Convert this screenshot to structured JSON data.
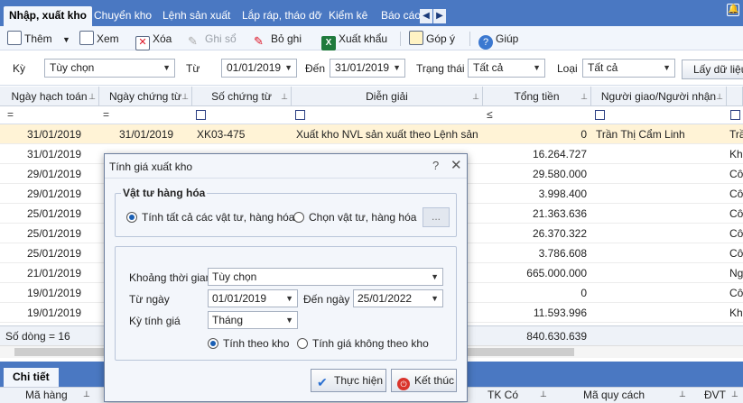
{
  "tabs": [
    "Nhập, xuất kho",
    "Chuyển kho",
    "Lệnh sản xuất",
    "Lắp ráp, tháo dỡ",
    "Kiểm kê",
    "Báo cáo"
  ],
  "toolbar": {
    "add": "Thêm",
    "view": "Xem",
    "delete": "Xóa",
    "post": "Ghi sổ",
    "unpost": "Bỏ ghi",
    "export": "Xuất khẩu",
    "feedback": "Góp ý",
    "help": "Giúp"
  },
  "filter": {
    "period_label": "Kỳ",
    "period_value": "Tùy chọn",
    "from_label": "Từ",
    "from_value": "01/01/2019",
    "to_label": "Đến",
    "to_value": "31/01/2019",
    "status_label": "Trạng thái",
    "status_value": "Tất cả",
    "type_label": "Loại",
    "type_value": "Tất cả",
    "fetch_button": "Lấy dữ liệu"
  },
  "grid": {
    "headers": [
      "Ngày hạch toán",
      "Ngày chứng từ",
      "Số chứng từ",
      "Diễn giải",
      "Tổng tiền",
      "Người giao/Người nhận",
      ""
    ],
    "filter_symbols": [
      "=",
      "=",
      "",
      "",
      "≤",
      "",
      ""
    ],
    "rows": [
      {
        "posting_date": "31/01/2019",
        "doc_date": "31/01/2019",
        "doc_no": "XK03-475",
        "desc": "Xuất kho NVL sản xuất theo Lệnh sản x",
        "total": "0",
        "person": "Trần Thị Cẩm Linh",
        "extra": "Trầ"
      },
      {
        "posting_date": "31/01/2019",
        "doc_date": "",
        "doc_no": "",
        "desc": "",
        "total": "16.264.727",
        "person": "",
        "extra": "Kha"
      },
      {
        "posting_date": "29/01/2019",
        "doc_date": "",
        "doc_no": "",
        "desc": "",
        "total": "29.580.000",
        "person": "",
        "extra": "Côn"
      },
      {
        "posting_date": "29/01/2019",
        "doc_date": "",
        "doc_no": "",
        "desc": "",
        "total": "3.998.400",
        "person": "",
        "extra": "Côn"
      },
      {
        "posting_date": "25/01/2019",
        "doc_date": "",
        "doc_no": "",
        "desc": "",
        "total": "21.363.636",
        "person": "",
        "extra": "Côn"
      },
      {
        "posting_date": "25/01/2019",
        "doc_date": "",
        "doc_no": "",
        "desc": "",
        "total": "26.370.322",
        "person": "",
        "extra": "Côn"
      },
      {
        "posting_date": "25/01/2019",
        "doc_date": "",
        "doc_no": "",
        "desc": "",
        "total": "3.786.608",
        "person": "",
        "extra": "Côn"
      },
      {
        "posting_date": "21/01/2019",
        "doc_date": "",
        "doc_no": "",
        "desc": "",
        "total": "665.000.000",
        "person": "",
        "extra": "Ngu"
      },
      {
        "posting_date": "19/01/2019",
        "doc_date": "",
        "doc_no": "",
        "desc": "",
        "total": "0",
        "person": "",
        "extra": "Côn"
      },
      {
        "posting_date": "19/01/2019",
        "doc_date": "",
        "doc_no": "",
        "desc": "",
        "total": "11.593.996",
        "person": "",
        "extra": "Kha"
      }
    ],
    "footer_count": "Số dòng = 16",
    "footer_total": "840.630.639"
  },
  "detail": {
    "tab": "Chi tiết",
    "headers": [
      "Mã hàng",
      "TK Có",
      "Mã quy cách",
      "ĐVT"
    ]
  },
  "dialog": {
    "title": "Tính giá xuất kho",
    "help": "?",
    "close": "✕",
    "group1_title": "Vật tư hàng hóa",
    "radio_all": "Tính tất cả các vật tư, hàng hóa",
    "radio_select": "Chọn vật tư, hàng hóa",
    "dots": "...",
    "period_label": "Khoảng thời gian",
    "period_value": "Tùy chọn",
    "from_label": "Từ ngày",
    "from_value": "01/01/2019",
    "to_label": "Đến ngày",
    "to_value": "25/01/2022",
    "pricing_label": "Kỳ tính giá",
    "pricing_value": "Tháng",
    "radio_by_warehouse": "Tính theo kho",
    "radio_no_warehouse": "Tính giá không theo kho",
    "execute_button": "Thực hiện",
    "finish_button": "Kết thúc"
  }
}
